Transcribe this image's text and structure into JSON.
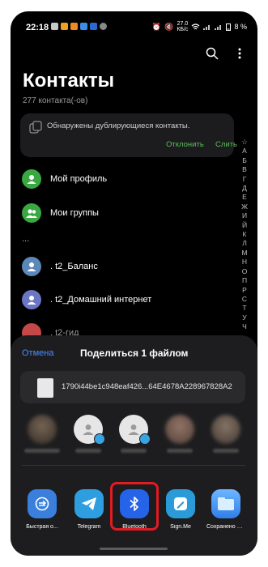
{
  "status_bar": {
    "time": "22:18",
    "speed": "27.0\nКБ/с",
    "battery": "8 %"
  },
  "header": {
    "title": "Контакты",
    "subtitle": "277 контакта(-ов)"
  },
  "duplicates": {
    "text": "Обнаружены дублирующиеся контакты.",
    "reject_label": "Отклонить",
    "merge_label": "Слить"
  },
  "alphabet": [
    "☆",
    "А",
    "Б",
    "В",
    "Г",
    "Д",
    "Е",
    "Ж",
    "И",
    "Й",
    "К",
    "Л",
    "М",
    "Н",
    "О",
    "П",
    "Р",
    "С",
    "Т",
    "У",
    "Ч"
  ],
  "contacts": [
    {
      "label": "Мой профиль",
      "color": "#3aa842"
    },
    {
      "label": "Мои группы",
      "color": "#3aa842"
    },
    {
      "label": "...",
      "color": ""
    },
    {
      "label": ". t2_Баланс",
      "color": "#5b88b8"
    },
    {
      "label": ". t2_Домашний интернет",
      "color": "#6b76c4"
    },
    {
      "label": ". t2-гид",
      "color": "#c44848"
    }
  ],
  "share": {
    "cancel_label": "Отмена",
    "title": "Поделиться 1 файлом",
    "file_name": "1790i44be1c948eaf426...64E4678A228967828A2"
  },
  "apps": [
    {
      "label": "Быстрая о...",
      "icon": "quick-share-icon",
      "color": "#3a7fdc"
    },
    {
      "label": "Telegram",
      "icon": "telegram-icon",
      "color": "#2e9ee0"
    },
    {
      "label": "Bluetooth",
      "icon": "bluetooth-icon",
      "color": "#2563e8"
    },
    {
      "label": "Sign.Me",
      "icon": "signme-icon",
      "color": "#2a9bd8"
    },
    {
      "label": "Сохранено в ...",
      "icon": "saved-folder-icon",
      "color": "#3d8ef0"
    }
  ],
  "colors": {
    "accent_green": "#5cbd5c",
    "accent_blue": "#4a8eff",
    "highlight_red": "#e01b22"
  }
}
